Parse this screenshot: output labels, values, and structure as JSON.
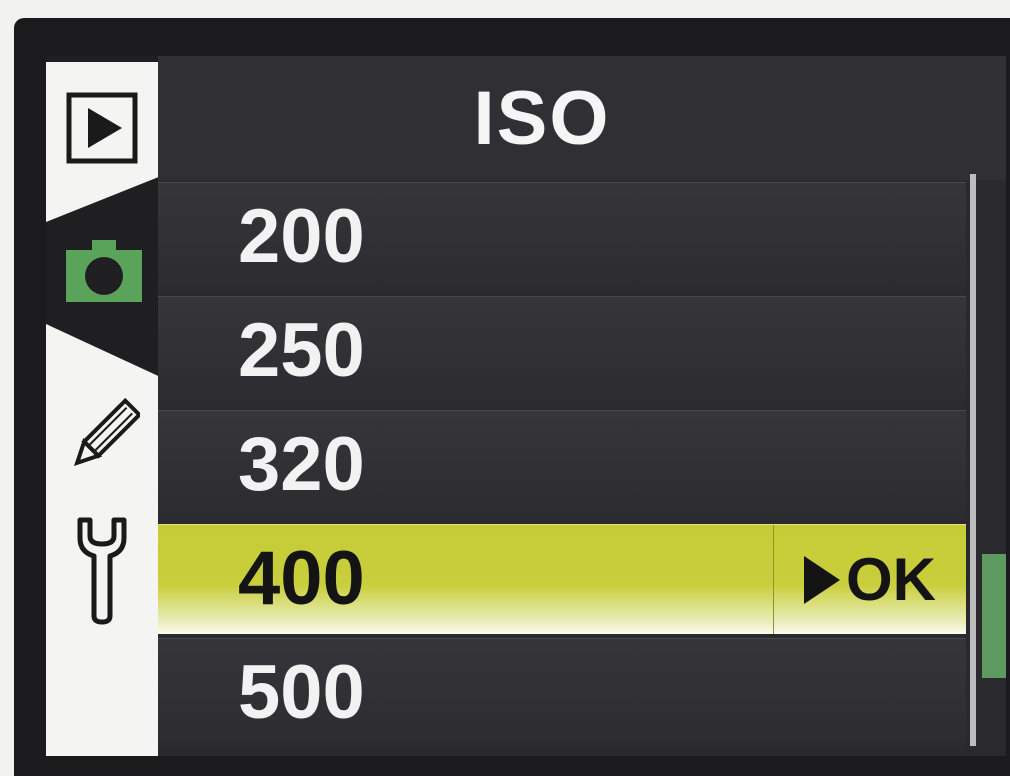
{
  "header": {
    "title": "ISO"
  },
  "tabs": [
    {
      "icon": "playback-icon",
      "active": false
    },
    {
      "icon": "camera-icon",
      "active": true,
      "accent": "#5aa35a"
    },
    {
      "icon": "pencil-icon",
      "active": false
    },
    {
      "icon": "wrench-icon",
      "active": false
    }
  ],
  "iso_options": [
    {
      "label": "200"
    },
    {
      "label": "250"
    },
    {
      "label": "320"
    },
    {
      "label": "400",
      "selected": true
    },
    {
      "label": "500"
    }
  ],
  "confirm": {
    "label": "OK"
  },
  "colors": {
    "highlight": "#c9cf3c",
    "scroll_thumb": "#5e9a5f"
  }
}
